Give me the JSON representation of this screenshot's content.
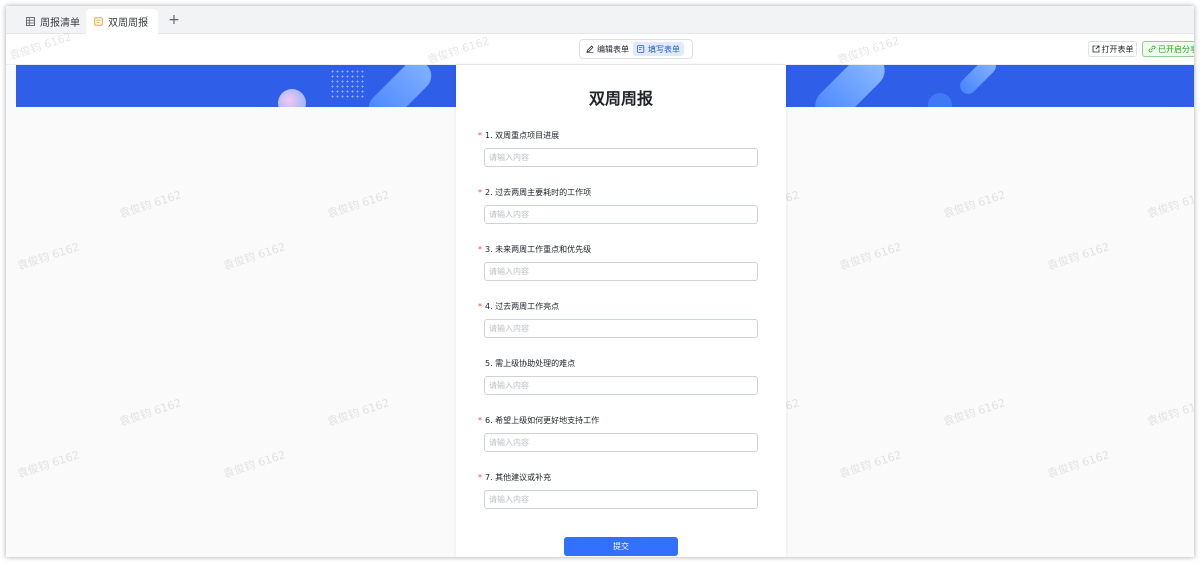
{
  "tabs": [
    {
      "label": "周报清单",
      "icon": "table-icon"
    },
    {
      "label": "双周周报",
      "icon": "form-icon",
      "more": "⋮"
    }
  ],
  "add_tab": "+",
  "toolbar": {
    "edit_form": "编辑表单",
    "fill_form": "填写表单",
    "open_form": "打开表单",
    "share": "已开启分享"
  },
  "form": {
    "title": "双周周报",
    "placeholder": "请输入内容",
    "questions": [
      {
        "label": "1. 双周重点项目进展",
        "required": true
      },
      {
        "label": "2. 过去两周主要耗时的工作项",
        "required": true
      },
      {
        "label": "3. 未来两周工作重点和优先级",
        "required": true
      },
      {
        "label": "4. 过去两周工作亮点",
        "required": true
      },
      {
        "label": "5. 需上级协助处理的难点",
        "required": false
      },
      {
        "label": "6. 希望上级如何更好地支持工作",
        "required": true
      },
      {
        "label": "7. 其他建议或补充",
        "required": true
      }
    ],
    "submit": "提交"
  },
  "watermark": "袁俊钧 6162",
  "colors": {
    "accent": "#3370ff",
    "banner": "#2f5ee8",
    "required": "#f54a45",
    "share": "#2ea121"
  }
}
